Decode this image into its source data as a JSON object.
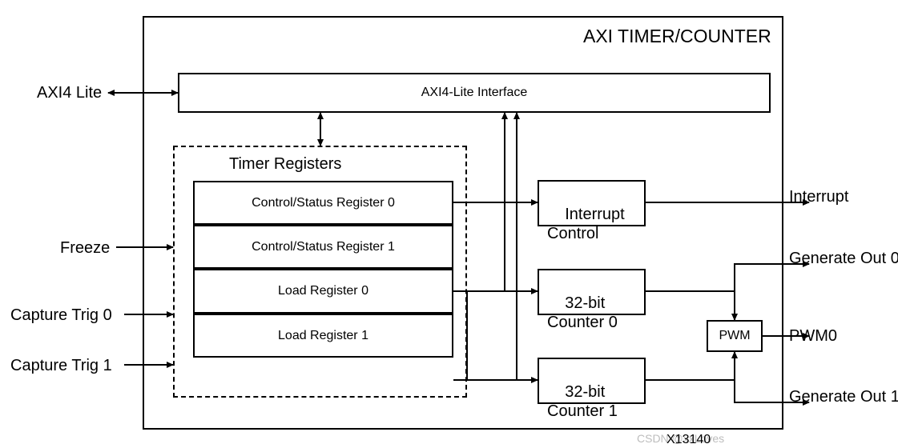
{
  "diagram": {
    "title": "AXI TIMER/COUNTER",
    "axi_interface": "AXI4-Lite Interface",
    "timer_registers_title": "Timer Registers",
    "registers": {
      "csr0": "Control/Status Register 0",
      "csr1": "Control/Status Register 1",
      "load0": "Load Register 0",
      "load1": "Load Register 1"
    },
    "blocks": {
      "irq": "Interrupt\nControl",
      "cnt0": "32-bit\nCounter 0",
      "cnt1": "32-bit\nCounter 1",
      "pwm": "PWM"
    },
    "ports": {
      "axi4": "AXI4 Lite",
      "freeze": "Freeze",
      "captrig0": "Capture Trig 0",
      "captrig1": "Capture Trig 1",
      "interrupt": "Interrupt",
      "genout0": "Generate Out 0",
      "pwm0": "PWM0",
      "genout1": "Generate Out 1"
    },
    "figure_id": "X13140",
    "watermark": "CSDN @xxLoves"
  }
}
